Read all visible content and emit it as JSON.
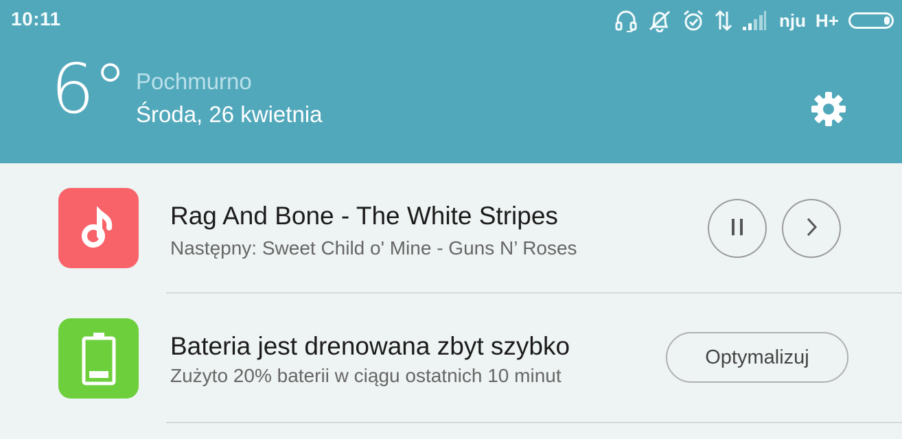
{
  "status_bar": {
    "time": "10:11",
    "carrier": "nju",
    "network": "H+",
    "icons": [
      "headset-icon",
      "notifications-muted-icon",
      "alarm-icon",
      "data-transfer-icon",
      "signal-icon",
      "battery-icon"
    ]
  },
  "weather": {
    "temperature": "6°",
    "condition": "Pochmurno",
    "date": "Środa, 26 kwietnia",
    "settings_icon": "gear-icon"
  },
  "notifications": [
    {
      "app_icon": "music-note-icon",
      "app_color": "#f8636a",
      "title": "Rag And Bone - The White Stripes",
      "subtitle": "Następny: Sweet Child o' Mine - Guns N’ Roses",
      "controls": [
        "pause-icon",
        "next-icon"
      ]
    },
    {
      "app_icon": "battery-icon",
      "app_color": "#6ccf3b",
      "title": "Bateria jest drenowana zbyt szybko",
      "subtitle": "Zużyto 20% baterii w ciągu ostatnich 10 minut",
      "action_label": "Optymalizuj"
    }
  ],
  "colors": {
    "header_bg": "#52a8bb",
    "panel_bg": "#eef4f3"
  }
}
